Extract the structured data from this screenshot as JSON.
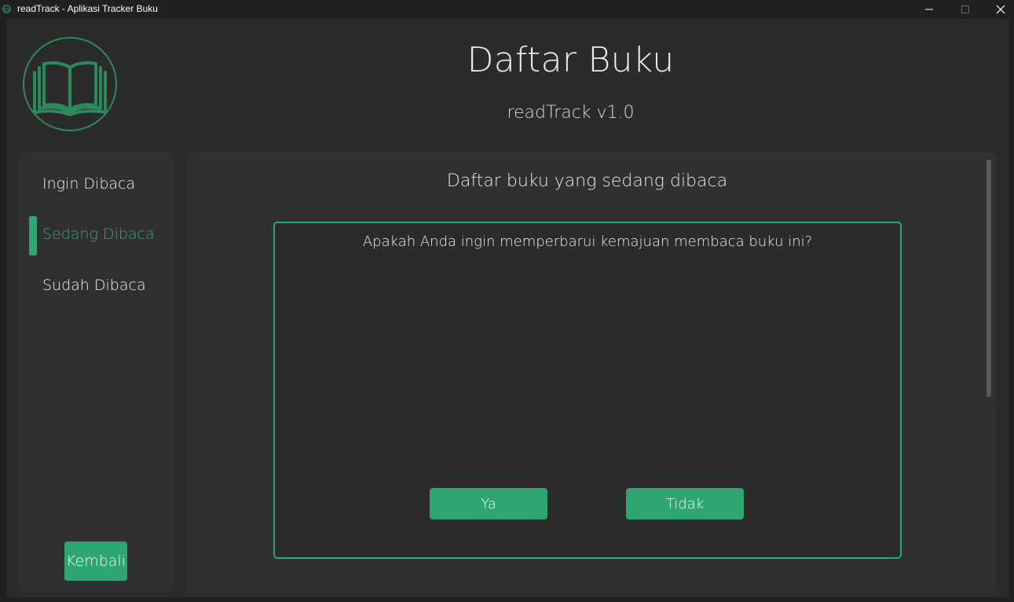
{
  "window": {
    "title": "readTrack - Aplikasi Tracker Buku",
    "controls": {
      "minimize_icon": "minimize-icon",
      "maximize_icon": "maximize-icon",
      "close_icon": "close-icon"
    }
  },
  "header": {
    "logo_icon": "open-book-icon",
    "title": "Daftar Buku",
    "subtitle": "readTrack v1.0"
  },
  "sidebar": {
    "items": [
      {
        "label": "Ingin Dibaca",
        "active": false
      },
      {
        "label": "Sedang Dibaca",
        "active": true
      },
      {
        "label": "Sudah Dibaca",
        "active": false
      }
    ],
    "back_label": "Kembali"
  },
  "main": {
    "heading": "Daftar buku yang sedang dibaca",
    "dialog": {
      "question": "Apakah Anda ingin memperbarui kemajuan membaca buku ini?",
      "yes_label": "Ya",
      "no_label": "Tidak"
    }
  },
  "colors": {
    "accent": "#2fa672",
    "background": "#2b2b2b",
    "panel": "#303030",
    "titlebar": "#202020"
  }
}
